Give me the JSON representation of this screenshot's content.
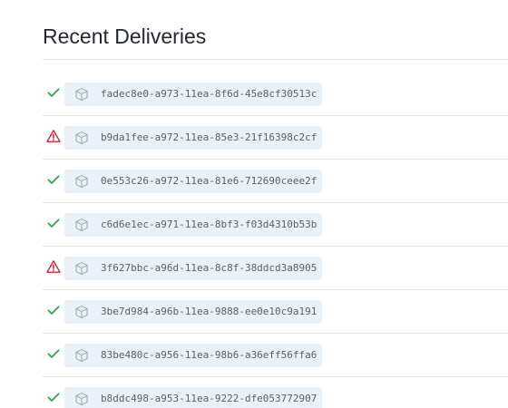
{
  "header": {
    "title": "Recent Deliveries"
  },
  "colors": {
    "success": "#28a745",
    "failure": "#cb2431",
    "pill_background": "#eaf1f8",
    "icon": "#a3b1bf"
  },
  "deliveries": [
    {
      "guid": "fadec8e0-a973-11ea-8f6d-45e8cf30513c",
      "status": "success",
      "status_icon": "check-icon",
      "type_icon": "package-icon"
    },
    {
      "guid": "b9da1fee-a972-11ea-85e3-21f16398c2cf",
      "status": "failure",
      "status_icon": "alert-icon",
      "type_icon": "package-icon"
    },
    {
      "guid": "0e553c26-a972-11ea-81e6-712690ceee2f",
      "status": "success",
      "status_icon": "check-icon",
      "type_icon": "package-icon"
    },
    {
      "guid": "c6d6e1ec-a971-11ea-8bf3-f03d4310b53b",
      "status": "success",
      "status_icon": "check-icon",
      "type_icon": "package-icon"
    },
    {
      "guid": "3f627bbc-a96d-11ea-8c8f-38ddcd3a8905",
      "status": "failure",
      "status_icon": "alert-icon",
      "type_icon": "package-icon"
    },
    {
      "guid": "3be7d984-a96b-11ea-9888-ee0e10c9a191",
      "status": "success",
      "status_icon": "check-icon",
      "type_icon": "package-icon"
    },
    {
      "guid": "83be480c-a956-11ea-98b6-a36eff56ffa6",
      "status": "success",
      "status_icon": "check-icon",
      "type_icon": "package-icon"
    },
    {
      "guid": "b8ddc498-a953-11ea-9222-dfe053772907",
      "status": "success",
      "status_icon": "check-icon",
      "type_icon": "package-icon"
    }
  ]
}
